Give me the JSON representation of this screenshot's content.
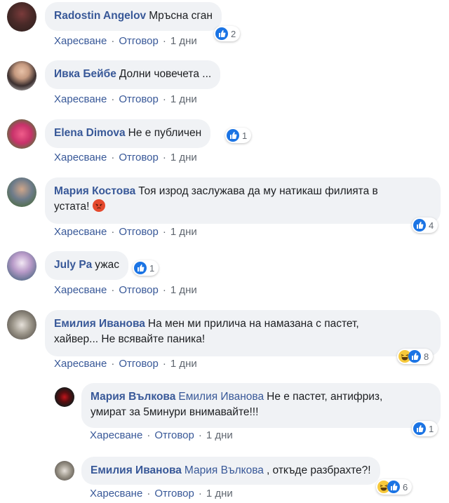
{
  "actions": {
    "like": "Харесване",
    "reply": "Отговор"
  },
  "comments": [
    {
      "author": "Radostin Angelov",
      "text": "Мръсна сган",
      "time": "1 дни",
      "reactions": {
        "types": [
          "like"
        ],
        "count": "2"
      }
    },
    {
      "author": "Ивка Бейбе",
      "text": "Долни човечета ...",
      "time": "1 дни"
    },
    {
      "author": "Elena Dimova",
      "text": "Не е публичен",
      "time": "1 дни",
      "reactions": {
        "types": [
          "like"
        ],
        "count": "1"
      }
    },
    {
      "author": "Мария Костова",
      "text": "Тоя изрод заслужава да му натикаш филията в",
      "text2": "устата!",
      "time": "1 дни",
      "reactions": {
        "types": [
          "like"
        ],
        "count": "4"
      }
    },
    {
      "author": "July Pa",
      "text": "ужас",
      "time": "1 дни",
      "reactions": {
        "types": [
          "like"
        ],
        "count": "1"
      }
    },
    {
      "author": "Емилия Иванова",
      "text": "На мен ми прилича на намазана с пастет,",
      "text2": "хайвер... Не всявайте паника!",
      "time": "1 дни",
      "reactions": {
        "types": [
          "haha",
          "like"
        ],
        "count": "8"
      }
    }
  ],
  "replies": [
    {
      "author": "Мария Вълкова",
      "mention": "Емилия Иванова",
      "text": "Не е пастет, антифриз,",
      "text2": "умират за 5минури внимавайте!!!",
      "time": "1 дни",
      "reactions": {
        "types": [
          "like"
        ],
        "count": "1"
      }
    },
    {
      "author": "Емилия Иванова",
      "mention": "Мария Вълкова",
      "text": ", откъде разбрахте?!",
      "time": "1 дни",
      "reactions": {
        "types": [
          "haha",
          "like"
        ],
        "count": "6"
      }
    }
  ]
}
